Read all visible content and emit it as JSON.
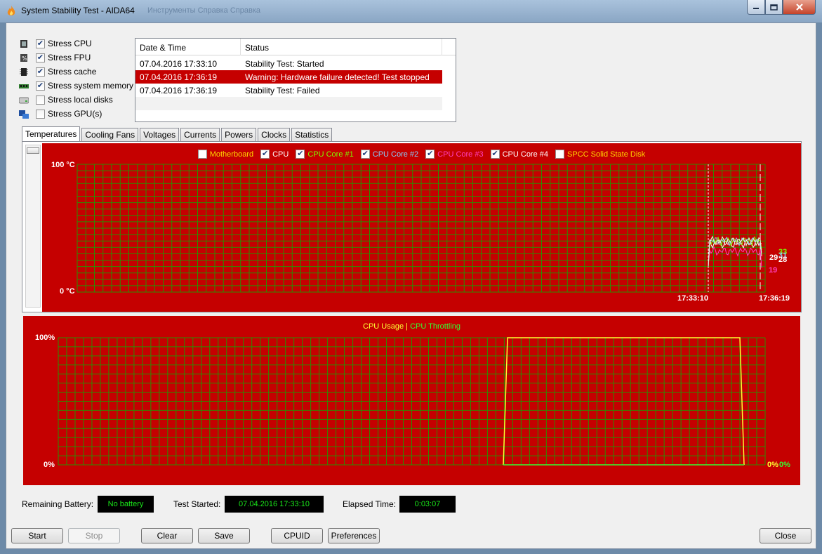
{
  "window": {
    "title": "System Stability Test - AIDA64",
    "background_menu_ghost": "Инструменты   Справка   Справка"
  },
  "stress_options": [
    {
      "label": "Stress CPU",
      "checked": true,
      "icon": "cpu-chip-icon"
    },
    {
      "label": "Stress FPU",
      "checked": true,
      "icon": "fpu-chip-icon"
    },
    {
      "label": "Stress cache",
      "checked": true,
      "icon": "cache-chip-icon"
    },
    {
      "label": "Stress system memory",
      "checked": true,
      "icon": "memory-module-icon"
    },
    {
      "label": "Stress local disks",
      "checked": false,
      "icon": "hard-disk-icon"
    },
    {
      "label": "Stress GPU(s)",
      "checked": false,
      "icon": "gpu-monitor-icon"
    }
  ],
  "log": {
    "columns": [
      "Date & Time",
      "Status"
    ],
    "rows": [
      {
        "datetime": "07.04.2016 17:33:10",
        "status": "Stability Test: Started",
        "highlight": false
      },
      {
        "datetime": "07.04.2016 17:36:19",
        "status": "Warning: Hardware failure detected! Test stopped",
        "highlight": true
      },
      {
        "datetime": "07.04.2016 17:36:19",
        "status": "Stability Test: Failed",
        "highlight": false
      }
    ]
  },
  "tabs": [
    "Temperatures",
    "Cooling Fans",
    "Voltages",
    "Currents",
    "Powers",
    "Clocks",
    "Statistics"
  ],
  "active_tab": "Temperatures",
  "temperature_chart": {
    "legend": [
      {
        "label": "Motherboard",
        "checked": false,
        "color": "#ffd700"
      },
      {
        "label": "CPU",
        "checked": true,
        "color": "#ffffff"
      },
      {
        "label": "CPU Core #1",
        "checked": true,
        "color": "#7cfc00"
      },
      {
        "label": "CPU Core #2",
        "checked": true,
        "color": "#87cefa"
      },
      {
        "label": "CPU Core #3",
        "checked": true,
        "color": "#ff3fbf"
      },
      {
        "label": "CPU Core #4",
        "checked": true,
        "color": "#ffffff"
      },
      {
        "label": "SPCC Solid State Disk",
        "checked": false,
        "color": "#ffd700"
      }
    ],
    "y_max_label": "100 °C",
    "y_min_label": "0 °C",
    "time_start": "17:33:10",
    "time_end": "17:36:19",
    "end_values": [
      {
        "value": "33",
        "color": "#7cfc00"
      },
      {
        "value": "31",
        "color": "#87cefa"
      },
      {
        "value": "29",
        "color": "#ffffff"
      },
      {
        "value": "28",
        "color": "#ffffff"
      },
      {
        "value": "19",
        "color": "#ff3fbf"
      }
    ]
  },
  "usage_chart": {
    "legend_usage": "CPU Usage",
    "legend_separator": "|",
    "legend_throttling": "CPU Throttling",
    "usage_color": "#ffff33",
    "throttle_color": "#33ff33",
    "y_max_label": "100%",
    "y_min_label": "0%",
    "end_usage": "0%",
    "end_throttling": "0%"
  },
  "status": {
    "battery_label": "Remaining Battery:",
    "battery_value": "No battery",
    "started_label": "Test Started:",
    "started_value": "07.04.2016 17:33:10",
    "elapsed_label": "Elapsed Time:",
    "elapsed_value": "0:03:07"
  },
  "buttons": {
    "start": "Start",
    "stop": "Stop",
    "clear": "Clear",
    "save": "Save",
    "cpuid": "CPUID",
    "preferences": "Preferences",
    "close": "Close"
  },
  "chart_data": [
    {
      "type": "line",
      "title": "",
      "ylabel": "",
      "ylim": [
        0,
        100
      ],
      "x": [
        "17:33:10",
        "17:36:19"
      ],
      "series": [
        {
          "name": "CPU",
          "values": [
            38,
            38
          ]
        },
        {
          "name": "CPU Core #1",
          "values": [
            40,
            33
          ]
        },
        {
          "name": "CPU Core #2",
          "values": [
            40,
            31
          ]
        },
        {
          "name": "CPU Core #3",
          "values": [
            32,
            19
          ]
        },
        {
          "name": "CPU Core #4",
          "values": [
            40,
            28
          ]
        }
      ]
    },
    {
      "type": "line",
      "title": "",
      "ylabel": "",
      "ylim": [
        0,
        100
      ],
      "series": [
        {
          "name": "CPU Usage",
          "values": [
            0,
            100,
            100,
            0
          ]
        },
        {
          "name": "CPU Throttling",
          "values": [
            0,
            0,
            0,
            0
          ]
        }
      ]
    }
  ]
}
